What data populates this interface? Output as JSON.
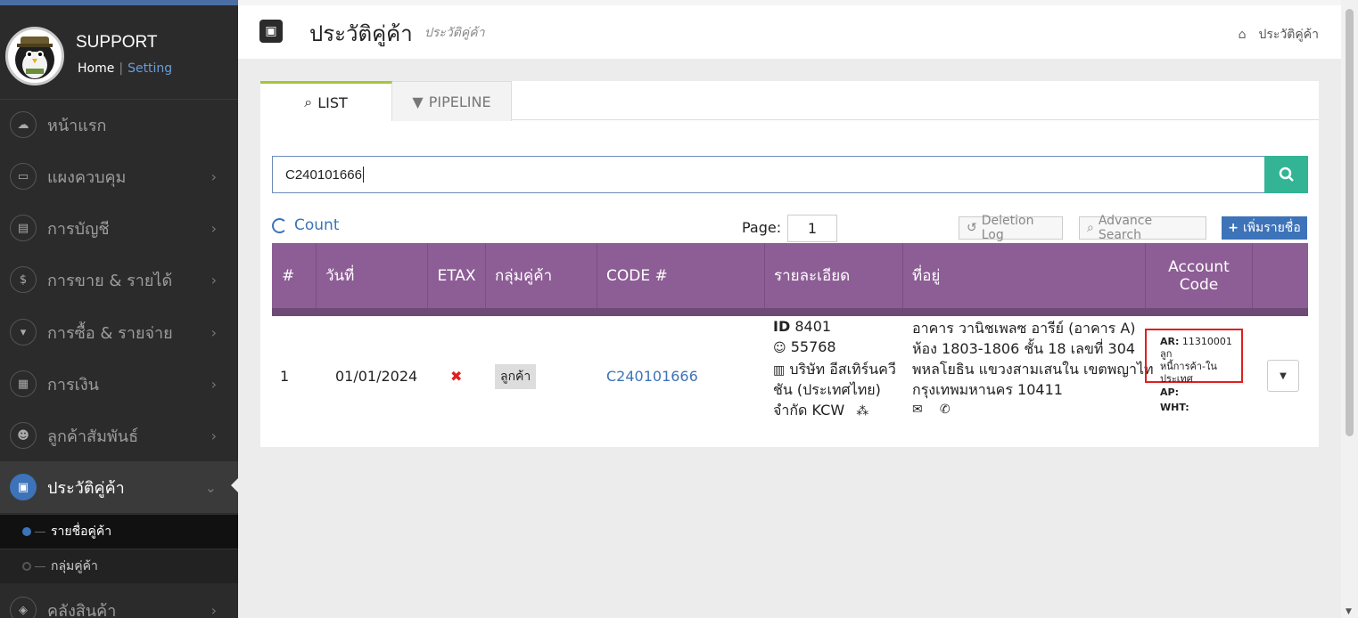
{
  "sidebar": {
    "profile": {
      "name": "SUPPORT",
      "home": "Home",
      "separator": "|",
      "setting": "Setting"
    },
    "menu": [
      {
        "label": "หน้าแรก",
        "icon": "cloud-icon",
        "glyph": "☁",
        "chevron": ""
      },
      {
        "label": "แผงควบคุม",
        "icon": "monitor-icon",
        "glyph": "▭",
        "chevron": "›"
      },
      {
        "label": "การบัญชี",
        "icon": "book-icon",
        "glyph": "▤",
        "chevron": "›"
      },
      {
        "label": "การขาย & รายได้",
        "icon": "dollar-icon",
        "glyph": "$",
        "chevron": "›"
      },
      {
        "label": "การซื้อ & รายจ่าย",
        "icon": "cart-icon",
        "glyph": "▾",
        "chevron": "›"
      },
      {
        "label": "การเงิน",
        "icon": "calendar-icon",
        "glyph": "▦",
        "chevron": "›"
      },
      {
        "label": "ลูกค้าสัมพันธ์",
        "icon": "users-icon",
        "glyph": "☻",
        "chevron": "›"
      },
      {
        "label": "ประวัติคู่ค้า",
        "icon": "contact-book-icon",
        "glyph": "▣",
        "chevron": "⌄"
      },
      {
        "label": "คลังสินค้า",
        "icon": "cubes-icon",
        "glyph": "◈",
        "chevron": "›"
      }
    ],
    "submenu": [
      {
        "label": "รายชื่อคู่ค้า"
      },
      {
        "label": "กลุ่มคู่ค้า"
      }
    ]
  },
  "header": {
    "title": "ประวัติคู่ค้า",
    "subtitle": "ประวัติคู่ค้า",
    "breadcrumb": "ประวัติคู่ค้า"
  },
  "tabs": {
    "list": "LIST",
    "pipeline": "PIPELINE"
  },
  "search": {
    "value": "C240101666"
  },
  "toolbar": {
    "count": "Count",
    "page_label": "Page:",
    "page_value": "1",
    "deletion_log": "Deletion Log",
    "advance_search": "Advance Search",
    "add_name": "เพิ่มรายชื่อ"
  },
  "table": {
    "headers": [
      "#",
      "วันที่",
      "ETAX",
      "กลุ่มคู่ค้า",
      "CODE #",
      "รายละเอียด",
      "ที่อยู่",
      "Account Code"
    ],
    "rows": [
      {
        "num": "1",
        "date": "01/01/2024",
        "etax": "✖",
        "group": "ลูกค้า",
        "code": "C240101666",
        "detail": {
          "id_label": "ID",
          "id": "8401",
          "user_id": "55768",
          "company_line1": "บริษัท อีสเทิร์นควี",
          "company_line2": "ชัน (ประเทศไทย)",
          "company_line3": "จำกัด KCW"
        },
        "address": {
          "line1": "อาคาร วานิชเพลซ อารีย์ (อาคาร A)",
          "line2": "ห้อง 1803-1806 ชั้น 18 เลขที่ 304",
          "line3": "พหลโยธิน แขวงสามเสนใน เขตพญาไท",
          "line4": "กรุงเทพมหานคร 10411"
        },
        "account": {
          "ar_label": "AR:",
          "ar_line1": "11310001 ลูก",
          "ar_line2": "หนี้การค้า-ใน",
          "ar_line3": "ประเทศ",
          "ap_label": "AP:",
          "wht_label": "WHT:"
        }
      }
    ]
  },
  "colors": {
    "accent": "#3d73b9",
    "table_header": "#8d5d95",
    "search_button": "#33b495",
    "tab_active": "#a4c639"
  }
}
